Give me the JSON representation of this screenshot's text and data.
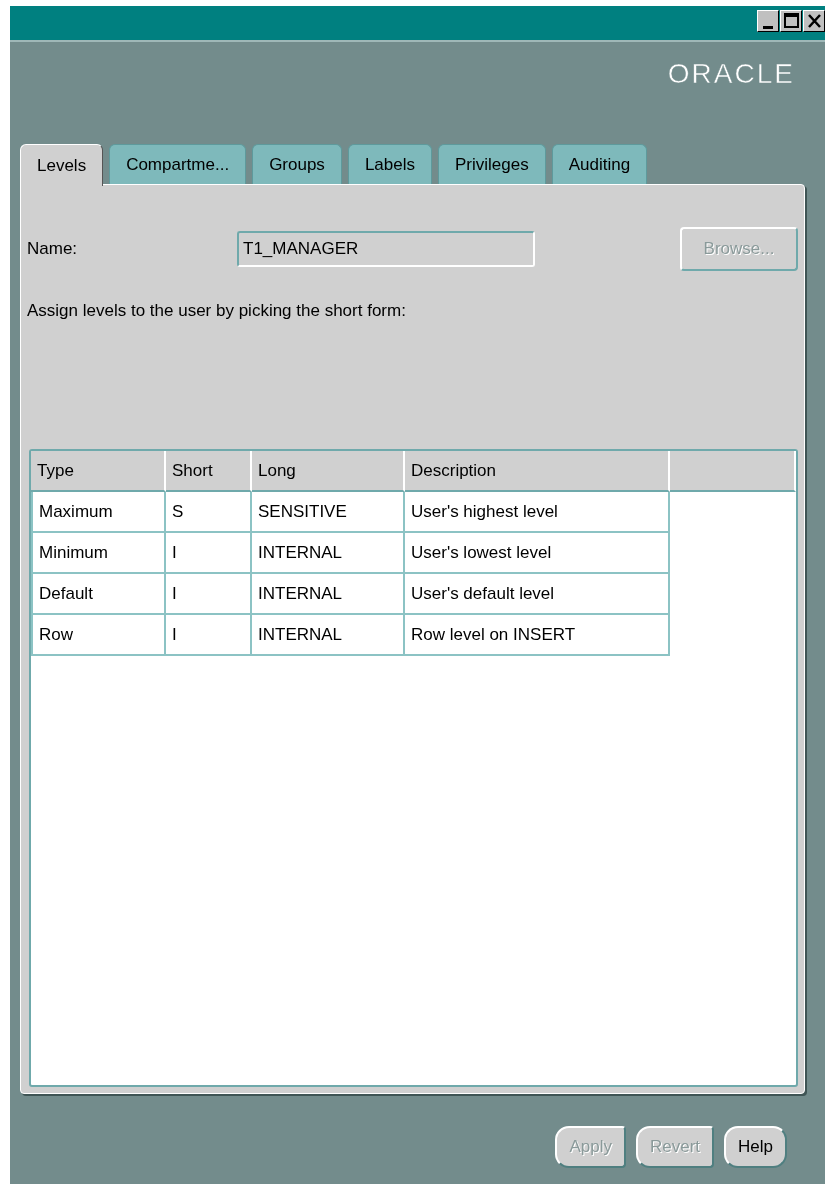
{
  "logo": "ORACLE",
  "tabs": [
    {
      "label": "Levels",
      "selected": true
    },
    {
      "label": "Compartme...",
      "selected": false
    },
    {
      "label": "Groups",
      "selected": false
    },
    {
      "label": "Labels",
      "selected": false
    },
    {
      "label": "Privileges",
      "selected": false
    },
    {
      "label": "Auditing",
      "selected": false
    }
  ],
  "name_field": {
    "label": "Name:",
    "value": "T1_MANAGER"
  },
  "browse_button": {
    "label": "Browse...",
    "disabled": true
  },
  "instruction": "Assign levels to the user by picking the short form:",
  "table": {
    "columns": [
      "Type",
      "Short",
      "Long",
      "Description"
    ],
    "rows": [
      [
        "Maximum",
        "S",
        "SENSITIVE",
        "User's highest level"
      ],
      [
        "Minimum",
        "I",
        "INTERNAL",
        "User's lowest level"
      ],
      [
        "Default",
        "I",
        "INTERNAL",
        "User's default level"
      ],
      [
        "Row",
        "I",
        "INTERNAL",
        "Row level on INSERT"
      ]
    ]
  },
  "buttons": [
    {
      "label": "Apply",
      "disabled": true
    },
    {
      "label": "Revert",
      "disabled": true
    },
    {
      "label": "Help",
      "disabled": false
    }
  ]
}
